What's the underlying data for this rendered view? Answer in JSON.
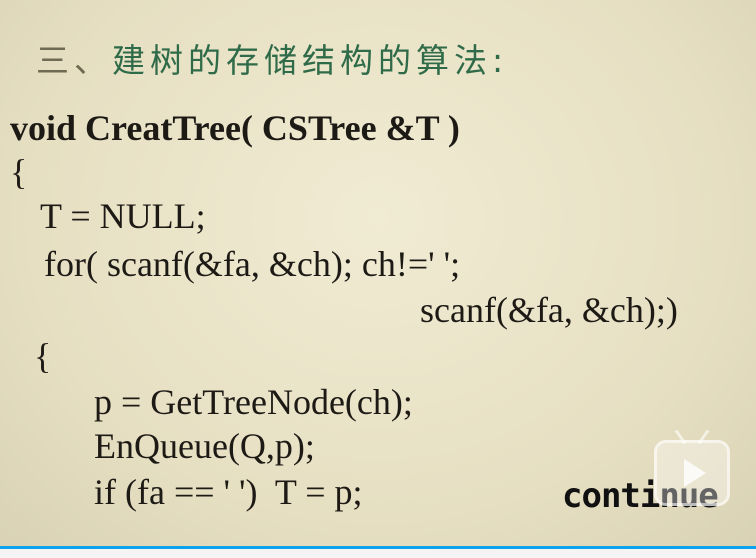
{
  "slide": {
    "title_num": "三、",
    "title_text": "建树的存储结构的算法:",
    "code": [
      "void CreatTree( CSTree &T )",
      "{",
      "T = NULL;",
      "for( scanf(&fa, &ch); ch!=' ';",
      "scanf(&fa, &ch);)",
      "{",
      "p = GetTreeNode(ch);",
      "EnQueue(Q,p);",
      "if (fa == ' ')  T = p;"
    ],
    "continue_label": "continue"
  },
  "player": {
    "play_icon": "play-icon",
    "progress": 1.0,
    "accent": "#0aa3ec"
  }
}
